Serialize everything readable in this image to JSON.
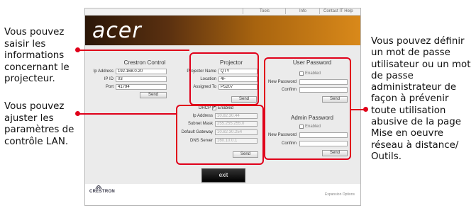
{
  "annotations": {
    "left_top": "Vous pouvez saisir les informations concernant le projecteur.",
    "left_bottom": "Vous pouvez ajuster les paramètres de contrôle LAN.",
    "right": "Vous pouvez définir un mot de passe utilisateur ou un mot de passe administrateur de façon à prévenir toute utilisation abusive de la page Mise en oeuvre réseau à distance/ Outils."
  },
  "topbar": {
    "tools": "Tools",
    "info": "Info",
    "contact": "Contact IT Help"
  },
  "brand": {
    "logo": "acer",
    "footer_logo": "CRESTRON",
    "expansion": "Expansion Options"
  },
  "crestron": {
    "title": "Crestron Control",
    "ip_label": "Ip Address",
    "ip_value": "192.168.0.20",
    "ipid_label": "IP ID",
    "ipid_value": "03",
    "port_label": "Port",
    "port_value": "41794",
    "send": "Send"
  },
  "projector": {
    "title": "Projector",
    "name_label": "Projector Name",
    "name_value": "QTY",
    "location_label": "Location",
    "location_value": "4F",
    "assigned_label": "Assigned To",
    "assigned_value": "P5207",
    "send": "Send"
  },
  "network": {
    "dhcp_label": "DHCP",
    "dhcp_enabled": "Enabled",
    "ip_label": "Ip Address",
    "ip_value": "10.82.30.44",
    "mask_label": "Subnet Mask",
    "mask_value": "255.255.255.0",
    "gateway_label": "Default Gateway",
    "gateway_value": "10.82.30.254",
    "dns_label": "DNS Server",
    "dns_value": "160.10.0.1",
    "send": "Send"
  },
  "user_password": {
    "title": "User Password",
    "enabled": "Enabled",
    "new_label": "New Password",
    "confirm_label": "Confirm",
    "send": "Send"
  },
  "admin_password": {
    "title": "Admin Password",
    "enabled": "Enabled",
    "new_label": "New Password",
    "confirm_label": "Confirm",
    "send": "Send"
  },
  "exit": "exit",
  "colors": {
    "highlight": "#e0001a",
    "banner_dark": "#2a1608",
    "banner_light": "#d9891a"
  }
}
